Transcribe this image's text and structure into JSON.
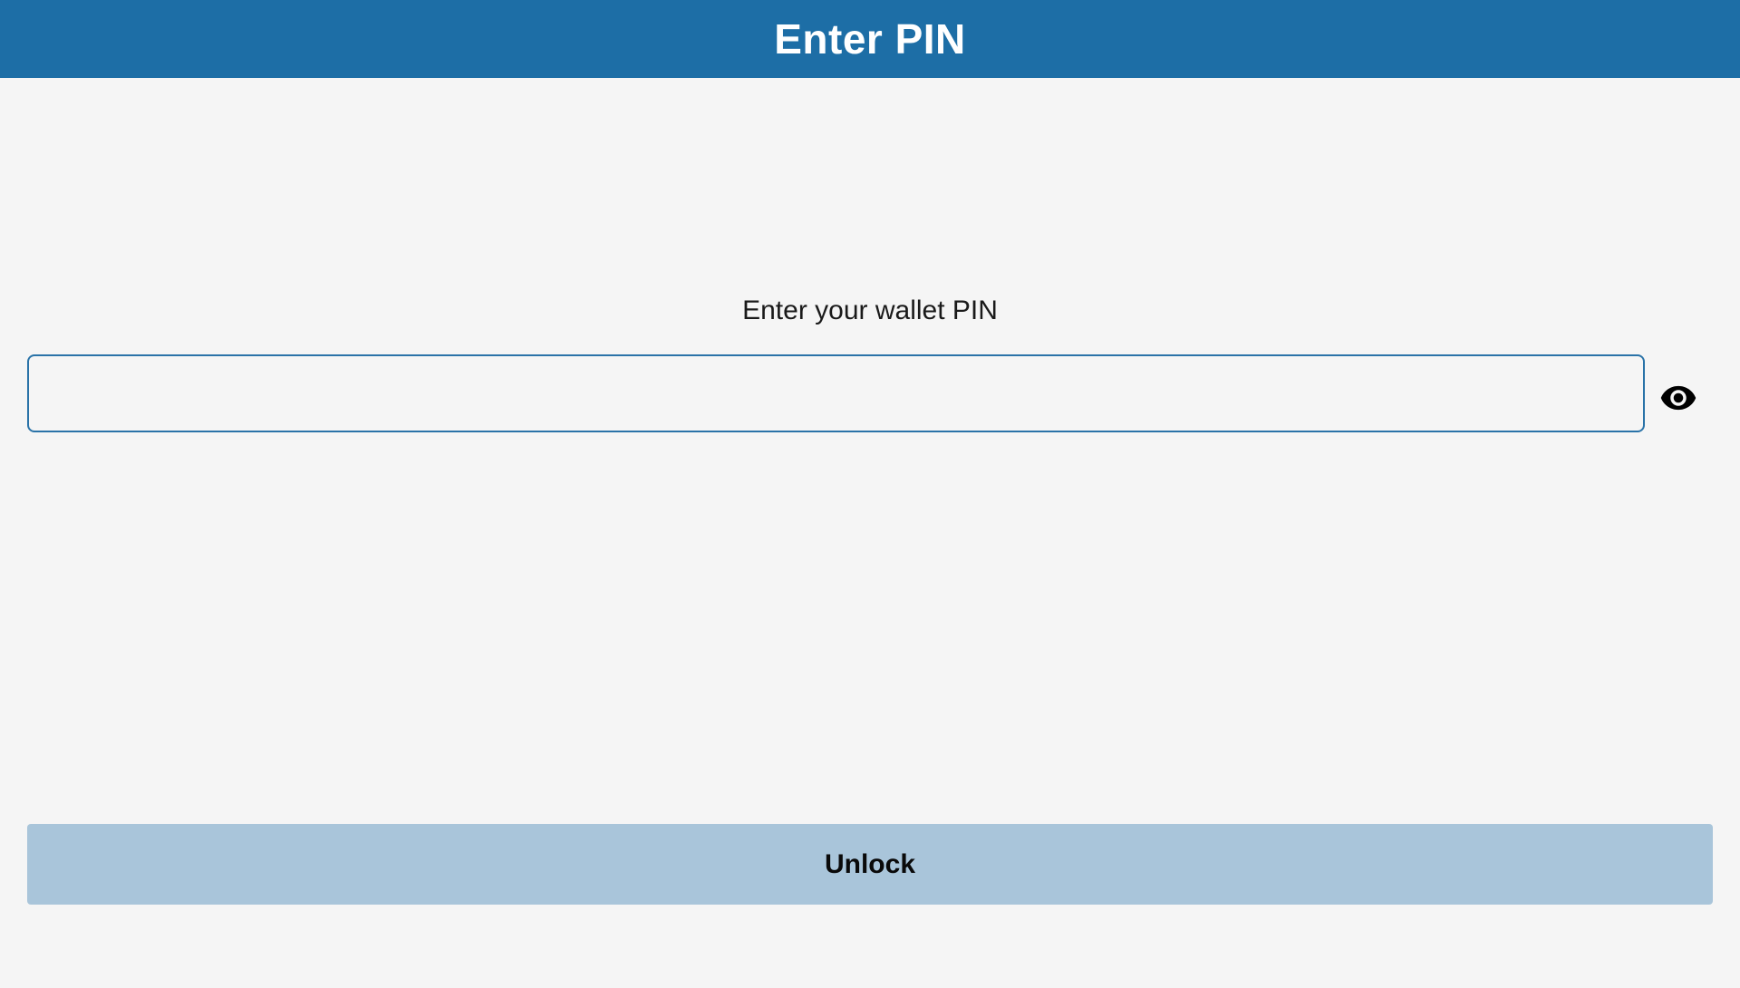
{
  "header": {
    "title": "Enter PIN"
  },
  "pin_form": {
    "label": "Enter your wallet PIN",
    "input_value": "",
    "input_placeholder": "",
    "visibility_icon": "eye-icon"
  },
  "actions": {
    "unlock_label": "Unlock"
  },
  "colors": {
    "header_background": "#1d6ea6",
    "page_background": "#f5f5f5",
    "input_border": "#2a73a8",
    "button_background": "#a9c5da"
  }
}
